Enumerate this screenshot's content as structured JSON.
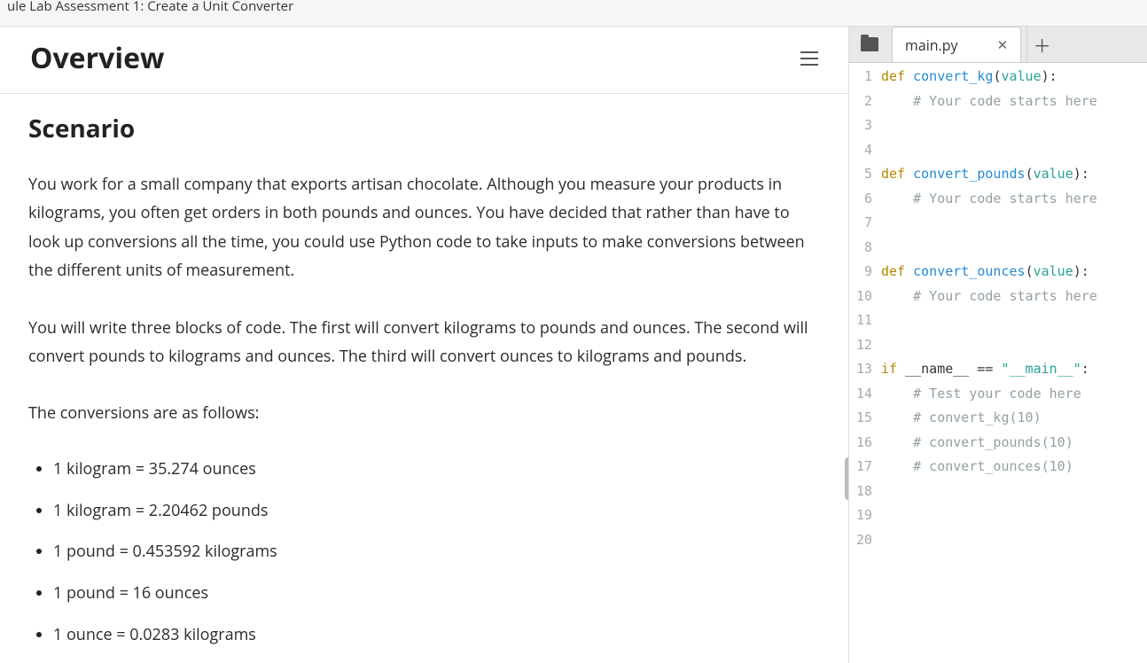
{
  "topbar": {
    "title": "ule Lab Assessment 1: Create a Unit Converter"
  },
  "left": {
    "overview_title": "Overview",
    "scenario_title": "Scenario",
    "p1": "You work for a small company that exports artisan chocolate. Although you measure your products in kilograms, you often get orders in both pounds and ounces. You have decided that rather than have to look up conversions all the time, you could use Python code to take inputs to make conversions between the different units of measurement.",
    "p2": "You will write three blocks of code. The first will convert kilograms to pounds and ounces. The second will convert pounds to kilograms and ounces. The third will convert ounces to kilograms and pounds.",
    "p3": "The conversions are as follows:",
    "bullets": [
      "1 kilogram = 35.274 ounces",
      "1 kilogram = 2.20462 pounds",
      "1 pound = 0.453592 kilograms",
      "1 pound = 16 ounces",
      "1 ounce = 0.0283 kilograms"
    ]
  },
  "editor": {
    "tab_name": "main.py",
    "lines": [
      {
        "n": 1,
        "t": [
          [
            "kw",
            "def "
          ],
          [
            "fn",
            "convert_kg"
          ],
          [
            "op",
            "("
          ],
          [
            "param",
            "value"
          ],
          [
            "op",
            "):"
          ]
        ]
      },
      {
        "n": 2,
        "t": [
          [
            "op",
            "    "
          ],
          [
            "cmt",
            "# Your code starts here"
          ]
        ]
      },
      {
        "n": 3,
        "t": [
          [
            "op",
            ""
          ]
        ]
      },
      {
        "n": 4,
        "t": [
          [
            "op",
            ""
          ]
        ]
      },
      {
        "n": 5,
        "t": [
          [
            "kw",
            "def "
          ],
          [
            "fn",
            "convert_pounds"
          ],
          [
            "op",
            "("
          ],
          [
            "param",
            "value"
          ],
          [
            "op",
            "):"
          ]
        ]
      },
      {
        "n": 6,
        "t": [
          [
            "op",
            "    "
          ],
          [
            "cmt",
            "# Your code starts here"
          ]
        ]
      },
      {
        "n": 7,
        "t": [
          [
            "op",
            ""
          ]
        ]
      },
      {
        "n": 8,
        "t": [
          [
            "op",
            ""
          ]
        ]
      },
      {
        "n": 9,
        "t": [
          [
            "kw",
            "def "
          ],
          [
            "fn",
            "convert_ounces"
          ],
          [
            "op",
            "("
          ],
          [
            "param",
            "value"
          ],
          [
            "op",
            "):"
          ]
        ]
      },
      {
        "n": 10,
        "t": [
          [
            "op",
            "    "
          ],
          [
            "cmt",
            "# Your code starts here"
          ]
        ]
      },
      {
        "n": 11,
        "t": [
          [
            "op",
            ""
          ]
        ]
      },
      {
        "n": 12,
        "t": [
          [
            "op",
            ""
          ]
        ]
      },
      {
        "n": 13,
        "t": [
          [
            "kw",
            "if"
          ],
          [
            "op",
            " __name__ "
          ],
          [
            "op",
            "== "
          ],
          [
            "str",
            "\"__main__\""
          ],
          [
            "op",
            ":"
          ]
        ]
      },
      {
        "n": 14,
        "t": [
          [
            "op",
            "    "
          ],
          [
            "cmt",
            "# Test your code here"
          ]
        ]
      },
      {
        "n": 15,
        "t": [
          [
            "op",
            "    "
          ],
          [
            "cmt",
            "# convert_kg(10)"
          ]
        ]
      },
      {
        "n": 16,
        "t": [
          [
            "op",
            "    "
          ],
          [
            "cmt",
            "# convert_pounds(10)"
          ]
        ]
      },
      {
        "n": 17,
        "t": [
          [
            "op",
            "    "
          ],
          [
            "cmt",
            "# convert_ounces(10)"
          ]
        ]
      },
      {
        "n": 18,
        "t": [
          [
            "op",
            ""
          ]
        ]
      },
      {
        "n": 19,
        "t": [
          [
            "op",
            ""
          ]
        ]
      },
      {
        "n": 20,
        "t": [
          [
            "op",
            ""
          ]
        ]
      }
    ]
  }
}
